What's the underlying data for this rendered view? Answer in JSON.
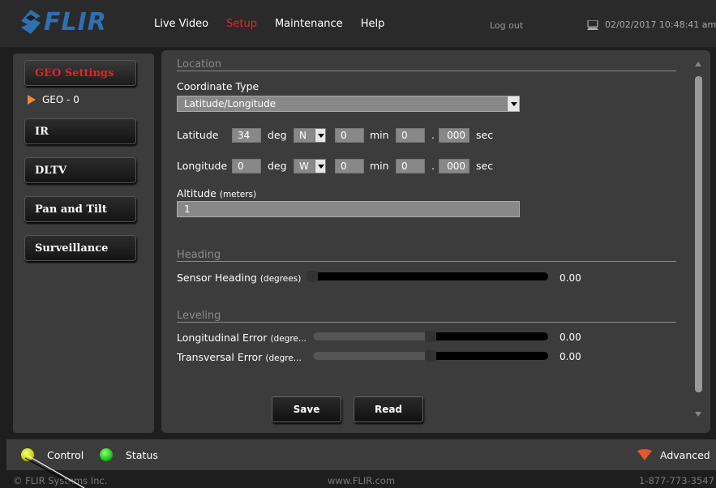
{
  "header": {
    "logo_text": "FLIR",
    "nav": [
      "Live Video",
      "Setup",
      "Maintenance",
      "Help"
    ],
    "active_nav": "Setup",
    "logout": "Log out",
    "datetime": "02/02/2017 10:48:41 am"
  },
  "sidebar": {
    "items": [
      {
        "label": "GEO Settings",
        "active": true
      },
      {
        "label": "IR"
      },
      {
        "label": "DLTV"
      },
      {
        "label": "Pan and Tilt"
      },
      {
        "label": "Surveillance"
      }
    ],
    "subitem": "GEO - 0"
  },
  "location": {
    "title": "Location",
    "coord_type_label": "Coordinate Type",
    "coord_type_value": "Latitude/Longitude",
    "latitude": {
      "label": "Latitude",
      "deg": "34",
      "deg_unit": "deg",
      "hemisphere": "N",
      "min": "0",
      "min_unit": "min",
      "sec": "0",
      "dot": ".",
      "sec_frac": "000",
      "sec_unit": "sec"
    },
    "longitude": {
      "label": "Longitude",
      "deg": "0",
      "deg_unit": "deg",
      "hemisphere": "W",
      "min": "0",
      "min_unit": "min",
      "sec": "0",
      "dot": ".",
      "sec_frac": "000",
      "sec_unit": "sec"
    },
    "altitude_label": "Altitude",
    "altitude_unit": "(meters)",
    "altitude_value": "1"
  },
  "heading": {
    "title": "Heading",
    "sensor_label": "Sensor Heading",
    "sensor_unit": "(degrees)",
    "sensor_value": "0.00",
    "sensor_level": 0.0
  },
  "leveling": {
    "title": "Leveling",
    "long_label": "Longitudinal Error",
    "long_unit": "(degre...",
    "long_value": "0.00",
    "long_level": 0.5,
    "trans_label": "Transversal Error",
    "trans_unit": "(degre...",
    "trans_value": "0.00",
    "trans_level": 0.5
  },
  "actions": {
    "save": "Save",
    "read": "Read"
  },
  "statusbar": {
    "control": "Control",
    "status": "Status",
    "advanced": "Advanced"
  },
  "footer": {
    "copyright": "© FLIR Systems Inc.",
    "website": "www.FLIR.com",
    "phone": "1-877-773-3547"
  },
  "colors": {
    "accent": "#e0242a",
    "logo": "#2f6fb3",
    "led_control": "#d8e000",
    "led_status": "#18c818"
  }
}
